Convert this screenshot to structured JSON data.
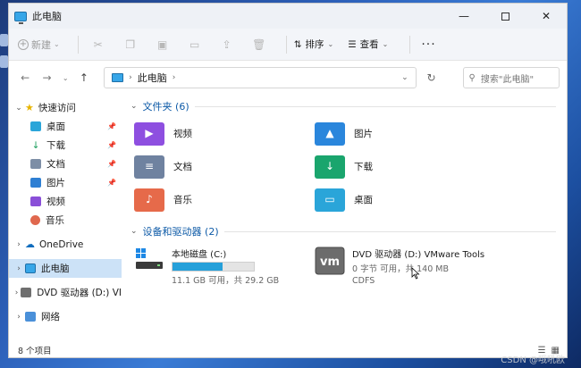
{
  "window": {
    "title": "此电脑"
  },
  "toolbar": {
    "new_label": "新建",
    "sort_label": "排序",
    "view_label": "查看",
    "more_label": "···"
  },
  "address": {
    "location": "此电脑",
    "search_placeholder": "搜索\"此电脑\""
  },
  "sidebar": {
    "items": [
      {
        "label": "快速访问"
      },
      {
        "label": "桌面"
      },
      {
        "label": "下载"
      },
      {
        "label": "文档"
      },
      {
        "label": "图片"
      },
      {
        "label": "视频"
      },
      {
        "label": "音乐"
      },
      {
        "label": "OneDrive"
      },
      {
        "label": "此电脑"
      },
      {
        "label": "DVD 驱动器 (D:) VI"
      },
      {
        "label": "网络"
      }
    ]
  },
  "main": {
    "folders_header": "文件夹 (6)",
    "folders": [
      {
        "name": "视频"
      },
      {
        "name": "图片"
      },
      {
        "name": "文档"
      },
      {
        "name": "下载"
      },
      {
        "name": "音乐"
      },
      {
        "name": "桌面"
      }
    ],
    "drives_header": "设备和驱动器 (2)",
    "drives": [
      {
        "name": "本地磁盘 (C:)",
        "detail": "11.1 GB 可用，共 29.2 GB",
        "used_fraction": 0.62
      },
      {
        "name": "DVD 驱动器 (D:) VMware Tools",
        "detail": "0 字节 可用，共 140 MB",
        "filesystem": "CDFS"
      }
    ]
  },
  "status": {
    "count_label": "8 个项目"
  },
  "colors": {
    "accent": "#0d5aa7",
    "selection": "#cce2f7",
    "progress": "#26a0da"
  },
  "desktop": {
    "watermark": "CSDN @哦吼欧"
  }
}
